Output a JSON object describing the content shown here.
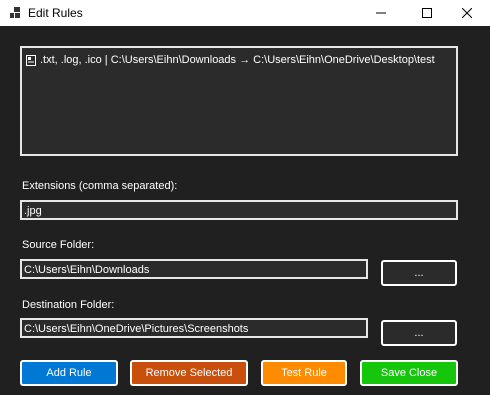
{
  "window": {
    "title": "Edit Rules"
  },
  "rules": {
    "items": [
      ".txt, .log, .ico | C:\\Users\\Eihn\\Downloads → C:\\Users\\Eihn\\OneDrive\\Desktop\\test"
    ]
  },
  "extensions": {
    "label": "Extensions (comma separated):",
    "value": ".jpg"
  },
  "source": {
    "label": "Source Folder:",
    "value": "C:\\Users\\Eihn\\Downloads",
    "browse_label": "..."
  },
  "destination": {
    "label": "Destination Folder:",
    "value": "C:\\Users\\Eihn\\OneDrive\\Pictures\\Screenshots",
    "browse_label": "..."
  },
  "actions": {
    "add_label": "Add Rule",
    "remove_label": "Remove Selected",
    "test_label": "Test Rule",
    "save_label": "Save  Close"
  },
  "colors": {
    "add": "#0078d4",
    "remove": "#c84f0c",
    "test": "#ff8c00",
    "save": "#16c60c"
  }
}
